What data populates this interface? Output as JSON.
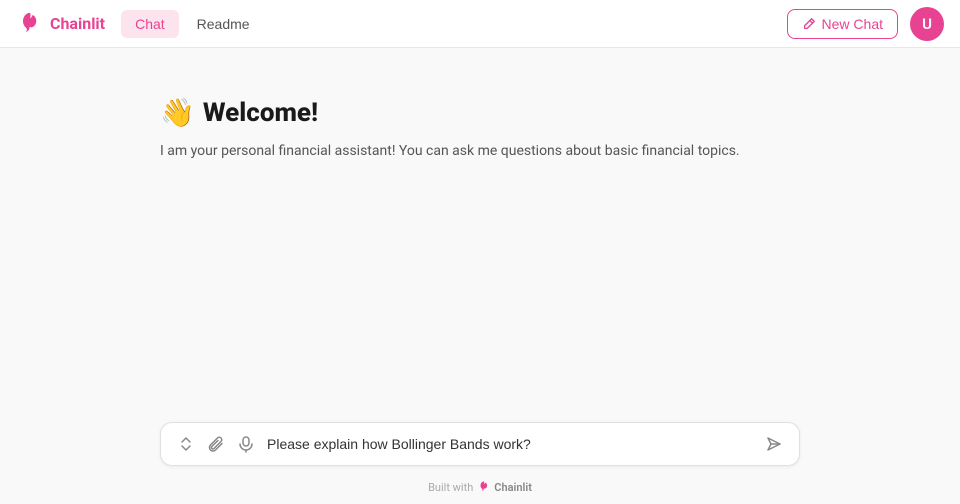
{
  "header": {
    "logo_text": "Chainlit",
    "tabs": [
      {
        "id": "chat",
        "label": "Chat",
        "active": true
      },
      {
        "id": "readme",
        "label": "Readme",
        "active": false
      }
    ],
    "new_chat_button_label": "New Chat",
    "avatar_initials": "U"
  },
  "main": {
    "welcome_emoji": "👋",
    "welcome_title": "Welcome!",
    "welcome_subtitle": "I am your personal financial assistant! You can ask me questions about basic financial topics."
  },
  "input": {
    "placeholder": "Please explain how Bollinger Bands work?",
    "current_value": "Please explain how Bollinger Bands work?"
  },
  "footer": {
    "built_with_label": "Built with",
    "brand_label": "Chainlit"
  }
}
